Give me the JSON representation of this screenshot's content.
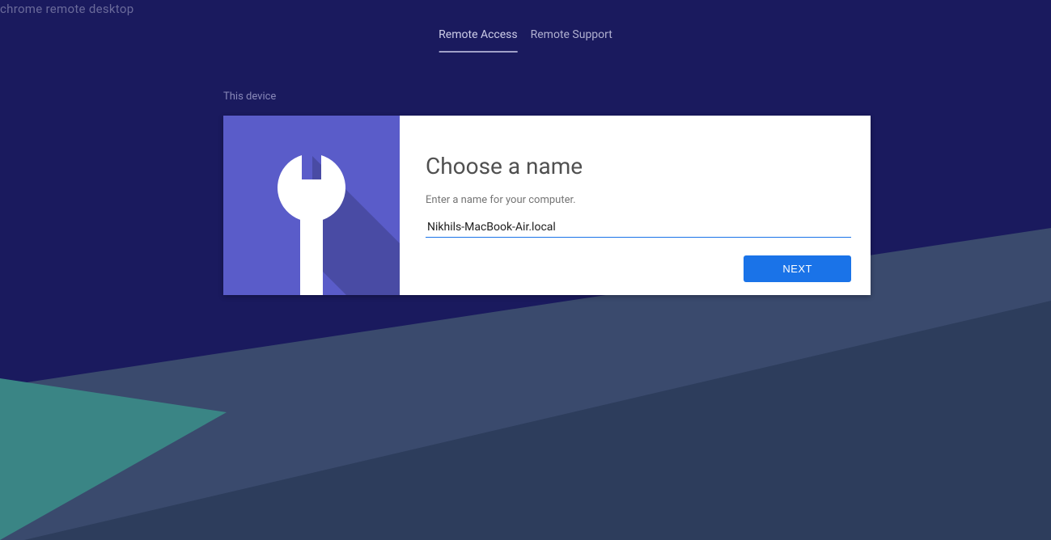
{
  "header": {
    "title": "chrome remote desktop"
  },
  "tabs": {
    "remote_access": "Remote Access",
    "remote_support": "Remote Support"
  },
  "section": {
    "label": "This device"
  },
  "card": {
    "title": "Choose a name",
    "subtitle": "Enter a name for your computer.",
    "input_value": "Nikhils-MacBook-Air.local",
    "next_button": "NEXT"
  }
}
